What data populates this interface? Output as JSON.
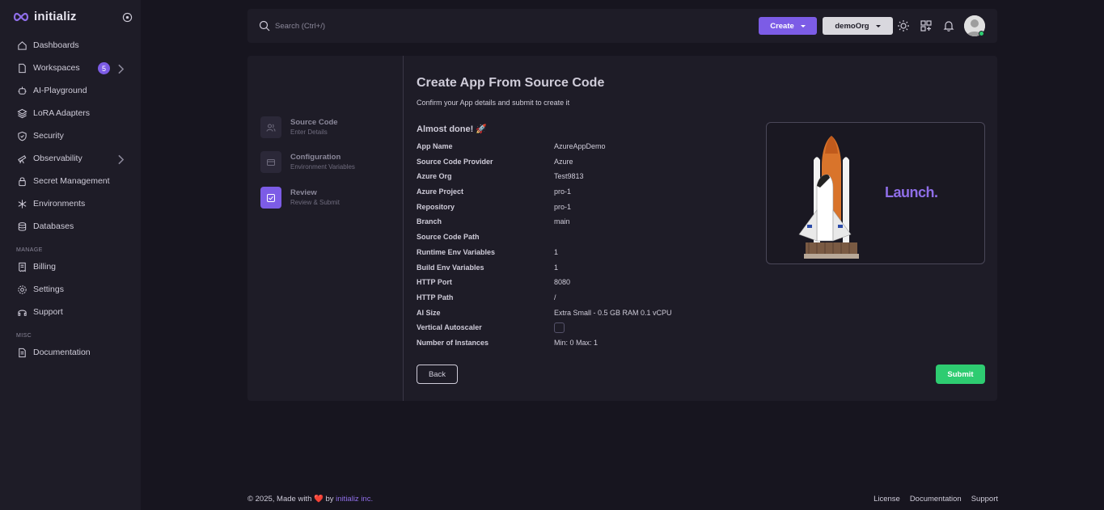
{
  "brand": {
    "name": "initializ"
  },
  "sidebar": {
    "items": [
      {
        "label": "Dashboards",
        "icon": "home-icon"
      },
      {
        "label": "Workspaces",
        "icon": "file-icon",
        "badge": "5"
      },
      {
        "label": "AI-Playground",
        "icon": "robot-icon"
      },
      {
        "label": "LoRA Adapters",
        "icon": "layers-icon"
      },
      {
        "label": "Security",
        "icon": "shield-icon"
      },
      {
        "label": "Observability",
        "icon": "telescope-icon"
      },
      {
        "label": "Secret Management",
        "icon": "lock-icon"
      },
      {
        "label": "Environments",
        "icon": "asterisk-icon"
      },
      {
        "label": "Databases",
        "icon": "database-icon"
      }
    ],
    "manage_label": "MANAGE",
    "manage_items": [
      {
        "label": "Billing",
        "icon": "receipt-icon"
      },
      {
        "label": "Settings",
        "icon": "gear-icon"
      },
      {
        "label": "Support",
        "icon": "headset-icon"
      }
    ],
    "misc_label": "MISC",
    "misc_items": [
      {
        "label": "Documentation",
        "icon": "document-icon"
      }
    ]
  },
  "topbar": {
    "search_placeholder": "Search (Ctrl+/)",
    "create_label": "Create",
    "org_label": "demoOrg"
  },
  "steps": [
    {
      "title": "Source Code",
      "subtitle": "Enter Details"
    },
    {
      "title": "Configuration",
      "subtitle": "Environment Variables"
    },
    {
      "title": "Review",
      "subtitle": "Review & Submit"
    }
  ],
  "main": {
    "title": "Create App From Source Code",
    "subtitle": "Confirm your App details and submit to create it",
    "almost_done": "Almost done! 🚀",
    "details": [
      {
        "key": "App Name",
        "value": "AzureAppDemo"
      },
      {
        "key": "Source Code Provider",
        "value": "Azure"
      },
      {
        "key": "Azure Org",
        "value": "Test9813"
      },
      {
        "key": "Azure Project",
        "value": "pro-1"
      },
      {
        "key": "Repository",
        "value": "pro-1"
      },
      {
        "key": "Branch",
        "value": "main"
      },
      {
        "key": "Source Code Path",
        "value": ""
      },
      {
        "key": "Runtime Env Variables",
        "value": "1"
      },
      {
        "key": "Build Env Variables",
        "value": "1"
      },
      {
        "key": "HTTP Port",
        "value": "8080"
      },
      {
        "key": "HTTP Path",
        "value": "/"
      },
      {
        "key": "AI Size",
        "value": "Extra Small - 0.5 GB RAM 0.1 vCPU"
      },
      {
        "key": "Vertical Autoscaler",
        "value": ""
      },
      {
        "key": "Number of Instances",
        "value": "Min: 0 Max: 1"
      }
    ],
    "launch_text": "Launch.",
    "back_label": "Back",
    "submit_label": "Submit"
  },
  "footer": {
    "copyright": "© 2025, Made with",
    "heart": "❤️",
    "by": "by",
    "company": "initializ inc.",
    "links": [
      "License",
      "Documentation",
      "Support"
    ]
  },
  "colors": {
    "accent": "#7c5ce6",
    "success": "#2ecc71",
    "background": "#17151f",
    "panel": "#1e1c27"
  }
}
